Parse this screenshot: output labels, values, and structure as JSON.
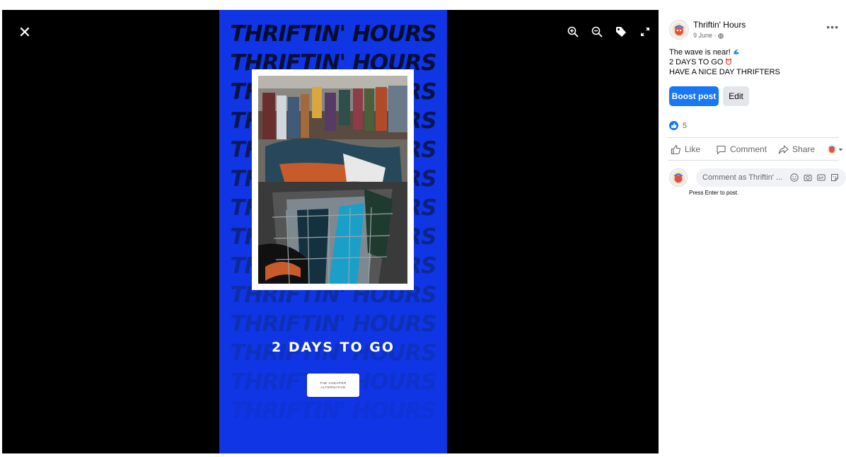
{
  "viewer": {
    "photo": {
      "repeated_text": "THRIFTIN' HOURS",
      "headline": "2 DAYS TO GO",
      "badge_text": "THE CHEAPER ALTERNATIVE",
      "colors": {
        "background": "#0f35e4",
        "text": "#050d2e"
      }
    },
    "tools": [
      {
        "icon": "zoom-in-icon"
      },
      {
        "icon": "zoom-out-icon"
      },
      {
        "icon": "tag-icon"
      },
      {
        "icon": "fullscreen-icon"
      }
    ]
  },
  "post": {
    "page_name": "Thriftin' Hours",
    "date": "9 June · ",
    "text_lines": [
      "The wave is near! ",
      "2 DAYS TO GO ",
      "HAVE A NICE DAY THRIFTERS"
    ],
    "boost_label": "Boost post",
    "edit_label": "Edit",
    "reaction_count": "5",
    "actions": {
      "like": "Like",
      "comment": "Comment",
      "share": "Share"
    },
    "comment_placeholder": "Comment as Thriftin' ...",
    "hint": "Press Enter to post.",
    "colors": {
      "accent": "#1877f2",
      "secondary_bg": "#e4e6eb"
    }
  }
}
